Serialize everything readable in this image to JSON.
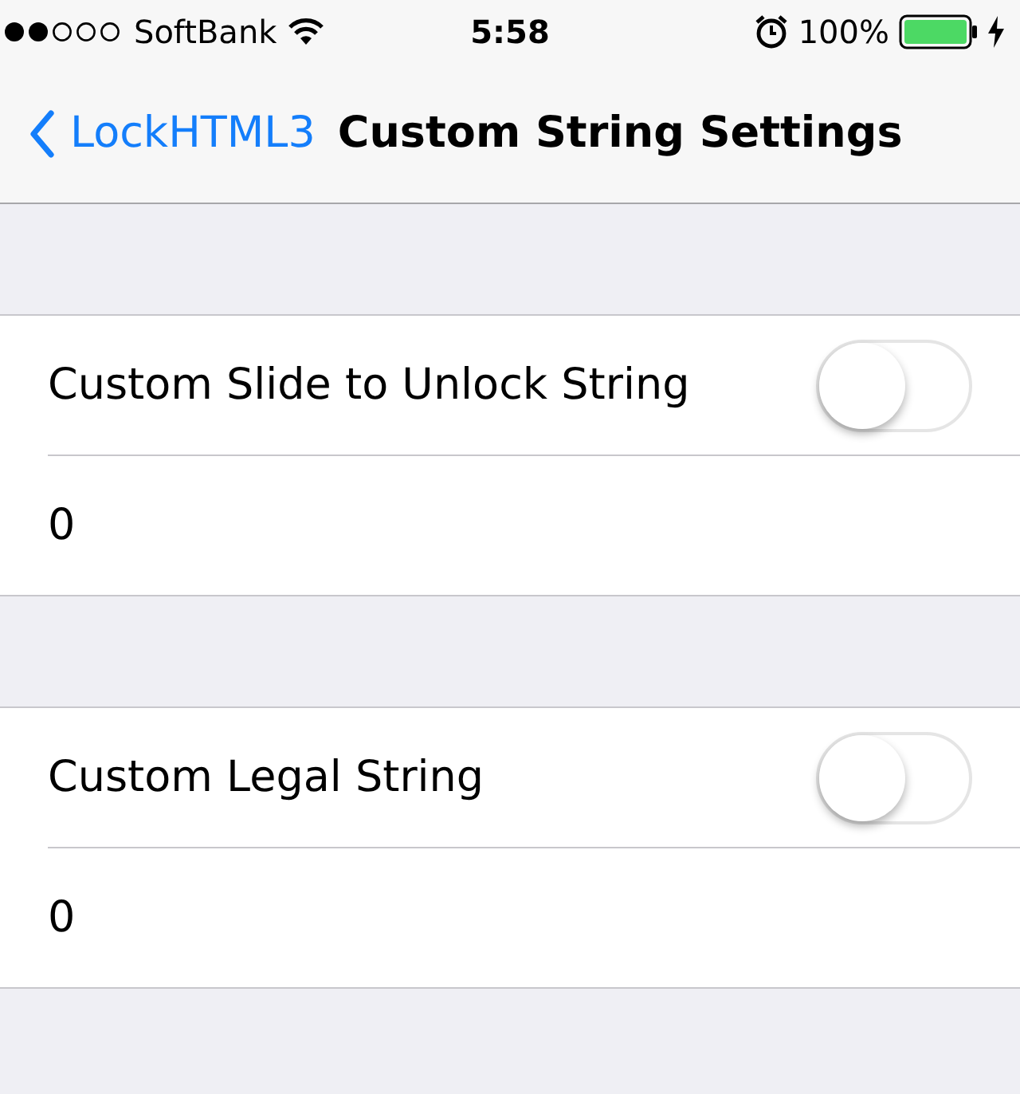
{
  "status_bar": {
    "carrier": "SoftBank",
    "time": "5:58",
    "battery": "100%"
  },
  "nav_bar": {
    "back": "LockHTML3",
    "title": "Custom String Settings"
  },
  "sections": [
    {
      "label": "Custom Slide to Unlock String",
      "on": false,
      "value": "0"
    },
    {
      "label": "Custom Legal String",
      "on": false,
      "value": "0"
    }
  ]
}
